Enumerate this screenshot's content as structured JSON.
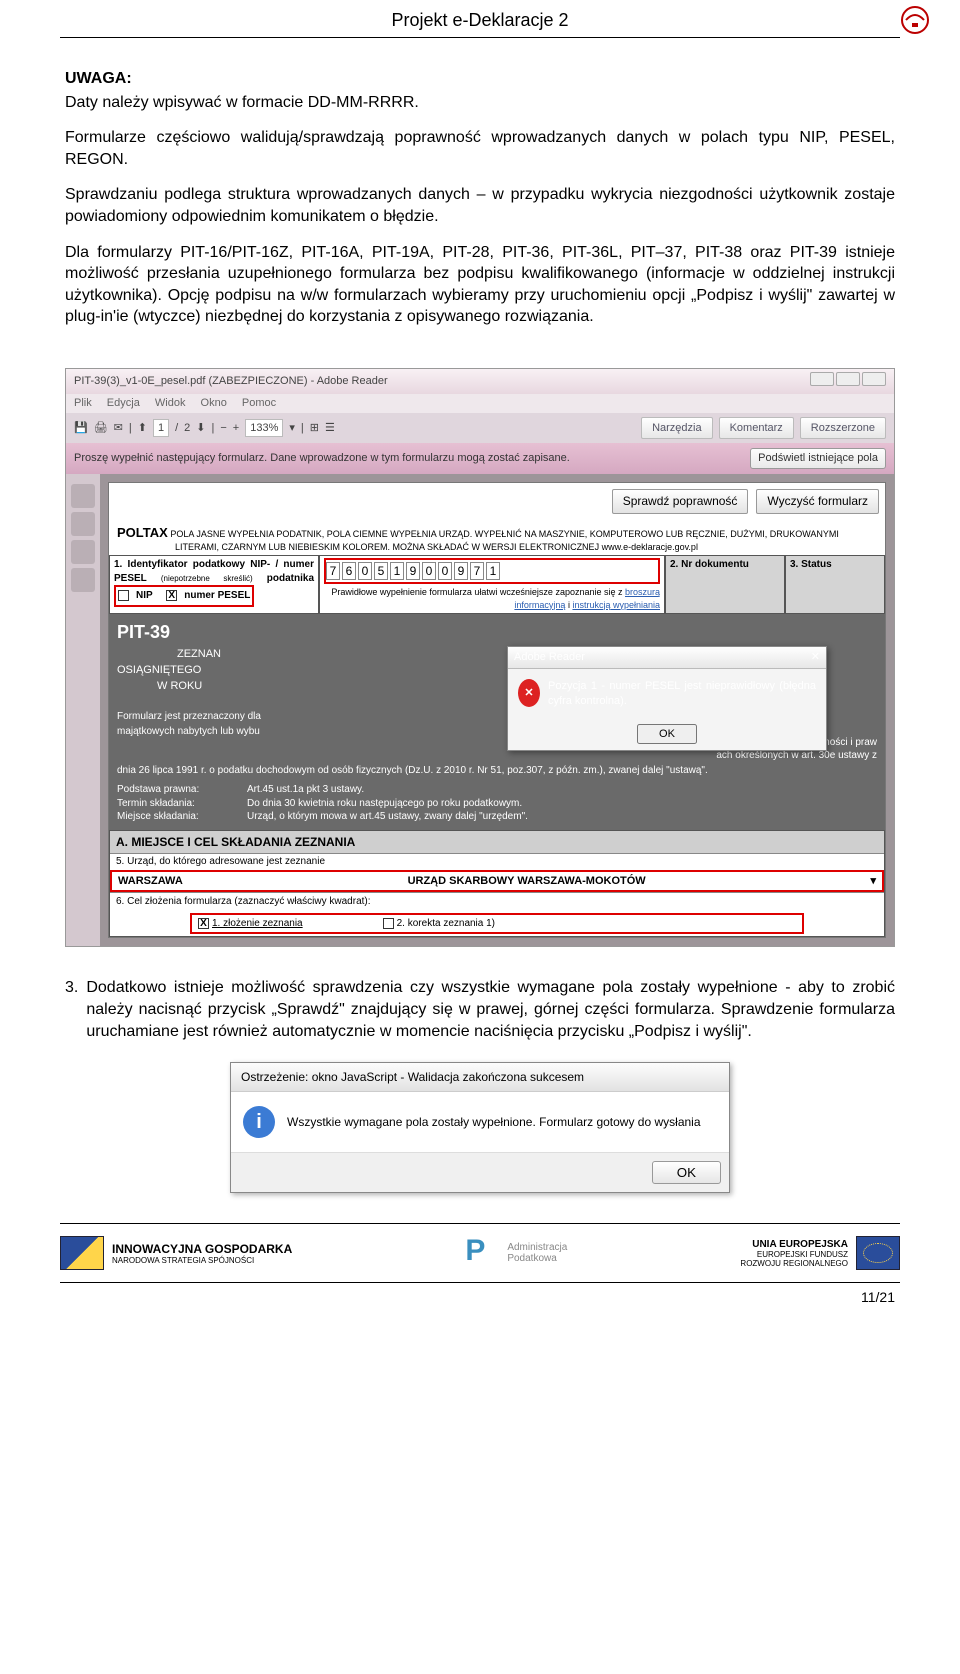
{
  "header": {
    "title": "Projekt e-Deklaracje 2"
  },
  "body": {
    "uwaga_label": "UWAGA:",
    "uwaga_text": "Daty należy wpisywać w formacie DD-MM-RRRR.",
    "p1": "Formularze częściowo walidują/sprawdzają poprawność wprowadzanych danych w polach typu NIP, PESEL, REGON.",
    "p2": "Sprawdzaniu podlega struktura wprowadzanych danych – w przypadku wykrycia niezgodności użytkownik zostaje powiadomiony odpowiednim komunikatem o błędzie.",
    "p3": "Dla formularzy PIT-16/PIT-16Z, PIT-16A, PIT-19A, PIT-28, PIT-36, PIT-36L, PIT–37, PIT-38 oraz PIT-39 istnieje możliwość przesłania uzupełnionego formularza bez podpisu kwalifikowanego (informacje w oddzielnej instrukcji użytkownika). Opcję podpisu na w/w formularzach wybieramy przy uruchomieniu opcji „Podpisz i wyślij\"  zawartej w plug-in'ie (wtyczce) niezbędnej do korzystania z opisywanego rozwiązania.",
    "item3_num": "3.",
    "item3": "Dodatkowo istnieje możliwość  sprawdzenia czy wszystkie wymagane pola zostały wypełnione - aby to zrobić należy nacisnąć przycisk „Sprawdź\" znajdujący się w prawej, górnej części formularza. Sprawdzenie formularza uruchamiane jest również automatycznie w momencie naciśnięcia przycisku „Podpisz i wyślij\"."
  },
  "screenshot": {
    "title": "PIT-39(3)_v1-0E_pesel.pdf (ZABEZPIECZONE) - Adobe Reader",
    "menu": {
      "plik": "Plik",
      "edycja": "Edycja",
      "widok": "Widok",
      "okno": "Okno",
      "pomoc": "Pomoc"
    },
    "toolbar": {
      "page1": "1",
      "pagesep": "/",
      "page2": "2",
      "zoom": "133%",
      "narzedzia": "Narzędzia",
      "komentarz": "Komentarz",
      "rozszerzone": "Rozszerzone"
    },
    "infobar": {
      "text": "Proszę wypełnić następujący formularz. Dane wprowadzone w tym formularzu mogą zostać zapisane.",
      "btn": "Podświetl istniejące pola"
    },
    "formbtns": {
      "sprawdz": "Sprawdź poprawność",
      "wyczysc": "Wyczyść formularz"
    },
    "poltax": {
      "brand": "POLTAX",
      "line1": "POLA JASNE WYPEŁNIA PODATNIK, POLA CIEMNE WYPEŁNIA URZĄD. WYPEŁNIĆ NA MASZYNIE, KOMPUTEROWO LUB RĘCZNIE, DUŻYMI, DRUKOWANYMI",
      "line2": "LITERAMI, CZARNYM LUB NIEBIESKIM KOLOREM.         MOŻNA SKŁADAĆ W WERSJI ELEKTRONICZNEJ    www.e-deklaracje.gov.pl"
    },
    "row1": {
      "label1": "1. Identyfikator podatkowy NIP- / numer PESEL",
      "sub1": "(niepotrzebne skreślić)",
      "sub2": " podatnika",
      "nip": "NIP",
      "pesel": "numer PESEL",
      "digits": [
        "7",
        "6",
        "0",
        "5",
        "1",
        "9",
        "0",
        "0",
        "9",
        "7",
        "1"
      ],
      "label2": "2. Nr dokumentu",
      "label3": "3. Status"
    },
    "bluehint": {
      "pre": "Prawidłowe wypełnienie formularza ułatwi wcześniejsze zapoznanie się z ",
      "link1": "broszurą informacyjną",
      "mid": "  i  ",
      "link2": "instrukcją wypełniania"
    },
    "dark": {
      "pit": "PIT-39",
      "l1": "ZEZNAN",
      "l2": "OSIĄGNIĘTEGO",
      "l3": "W ROKU",
      "fp": "Formularz jest przeznaczony dla",
      "mp1": "majątkowych nabytych lub wybu",
      "mp2": "dnia 26 lipca 1991 r. o podatku dochodowym od osób fizycznych (Dz.U. z 2010 r. Nr 51, poz.307, z późn. zm.), zwanej dalej \"ustawą\".",
      "mp_r1": "łatnego zbycia nieruchomości i praw",
      "mp_r2": "ach  określonych w art.  30e ustawy z",
      "pp_l": "Podstawa prawna:",
      "pp_v": "Art.45 ust.1a pkt 3 ustawy.",
      "ts_l": "Termin składania:",
      "ts_v": "Do dnia 30 kwietnia roku następującego po roku podatkowym.",
      "ms_l": "Miejsce składania:",
      "ms_v": "Urząd, o którym mowa w art.45 ustawy, zwany dalej \"urzędem\"."
    },
    "dialog": {
      "title": "Adobe Reader",
      "msg": "Pozycja 1 - numer PESEL jest nieprawidłowy (błędna cyfra kontrolna).",
      "ok": "OK"
    },
    "secA": {
      "hdr": "A. MIEJSCE I CEL SKŁADANIA ZEZNANIA",
      "sub5": "5. Urząd, do którego adresowane jest zeznanie",
      "warsz": "WARSZAWA",
      "urzad": "URZĄD SKARBOWY WARSZAWA-MOKOTÓW",
      "dd": "▾",
      "sub6": "6. Cel złożenia formularza  (zaznaczyć właściwy kwadrat):",
      "opt1": "1. złożenie zeznania",
      "opt2": "2. korekta zeznania 1)"
    }
  },
  "dialog2": {
    "title": "Ostrzeżenie: okno JavaScript - Walidacja zakończona sukcesem",
    "msg": "Wszystkie wymagane pola zostały wypełnione. Formularz gotowy do wysłania",
    "ok": "OK"
  },
  "footer": {
    "inn1": "INNOWACYJNA GOSPODARKA",
    "inn2": "NARODOWA STRATEGIA SPÓJNOŚCI",
    "adm1": "Administracja",
    "adm2": "Podatkowa",
    "eu1": "UNIA EUROPEJSKA",
    "eu2": "EUROPEJSKI FUNDUSZ",
    "eu3": "ROZWOJU REGIONALNEGO",
    "pagenum": "11/21"
  }
}
